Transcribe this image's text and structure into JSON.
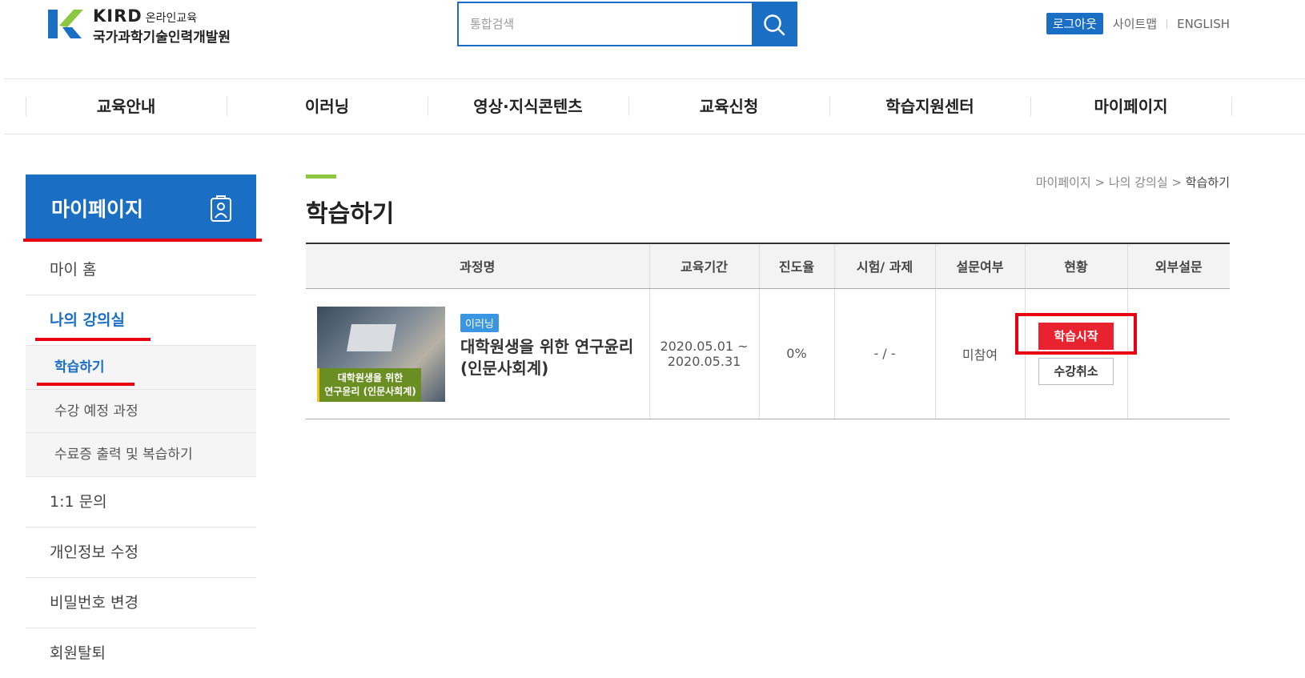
{
  "header": {
    "logo_abbr": "KIRD",
    "logo_sub": "온라인교육",
    "logo_name": "국가과학기술인력개발원",
    "search_placeholder": "통합검색",
    "search_icon": "search-icon",
    "util": {
      "logout": "로그아웃",
      "sitemap": "사이트맵",
      "english": "ENGLISH"
    }
  },
  "gnb": [
    "교육안내",
    "이러닝",
    "영상·지식콘텐츠",
    "교육신청",
    "학습지원센터",
    "마이페이지"
  ],
  "sidebar": {
    "title": "마이페이지",
    "title_icon": "id-badge-icon",
    "items": {
      "home": "마이 홈",
      "classroom": "나의 강의실",
      "study": "학습하기",
      "planned": "수강 예정 과정",
      "certificate": "수료증 출력 및 복습하기",
      "inquiry": "1:1 문의",
      "profile": "개인정보 수정",
      "password": "비밀번호 변경",
      "withdraw": "회원탈퇴"
    }
  },
  "content": {
    "title": "학습하기",
    "breadcrumb": {
      "b1": "마이페이지",
      "b2": "나의 강의실",
      "current": "학습하기",
      "sep": ">"
    },
    "table": {
      "headers": [
        "과정명",
        "교육기간",
        "진도율",
        "시험/ 과제",
        "설문여부",
        "현황",
        "외부설문"
      ],
      "row": {
        "tag": "이러닝",
        "title_line1": "대학원생을 위한 연구윤리",
        "title_line2": "(인문사회계)",
        "thumb_line1": "대학원생을 위한",
        "thumb_line2": "연구윤리 (인문사회계)",
        "period_start": "2020.05.01 ~",
        "period_end": "2020.05.31",
        "progress": "0%",
        "exam": "- / -",
        "survey": "미참여",
        "start_btn": "학습시작",
        "cancel_btn": "수강취소",
        "external": ""
      }
    }
  },
  "colors": {
    "primary": "#1a6fc4",
    "highlight": "#e60012",
    "accent": "#8dc63f",
    "start": "#e8222f"
  }
}
